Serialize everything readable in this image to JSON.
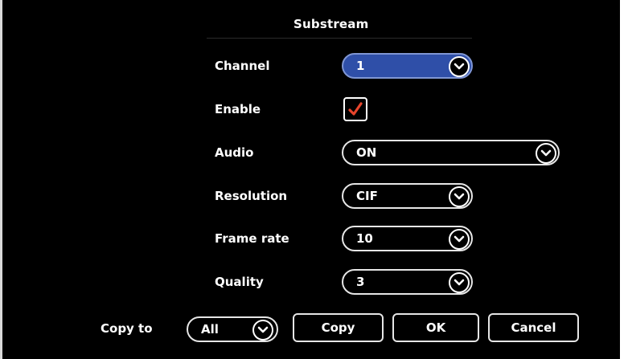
{
  "dialog": {
    "title": "Substream"
  },
  "form": {
    "channel": {
      "label": "Channel",
      "value": "1",
      "icon": "chevron-down-icon"
    },
    "enable": {
      "label": "Enable",
      "checked": true,
      "icon": "checkmark-icon"
    },
    "audio": {
      "label": "Audio",
      "value": "ON",
      "icon": "chevron-down-icon"
    },
    "resolution": {
      "label": "Resolution",
      "value": "CIF",
      "icon": "chevron-down-icon"
    },
    "frame_rate": {
      "label": "Frame rate",
      "value": "10",
      "icon": "chevron-down-icon"
    },
    "quality": {
      "label": "Quality",
      "value": "3",
      "icon": "chevron-down-icon"
    }
  },
  "footer": {
    "copy_to_label": "Copy to",
    "copy_to_value": "All",
    "copy_button": "Copy",
    "ok_button": "OK",
    "cancel_button": "Cancel"
  },
  "colors": {
    "background": "#000000",
    "text": "#ffffff",
    "selected_field": "#2f4fa8",
    "checkmark": "#e8452c"
  }
}
